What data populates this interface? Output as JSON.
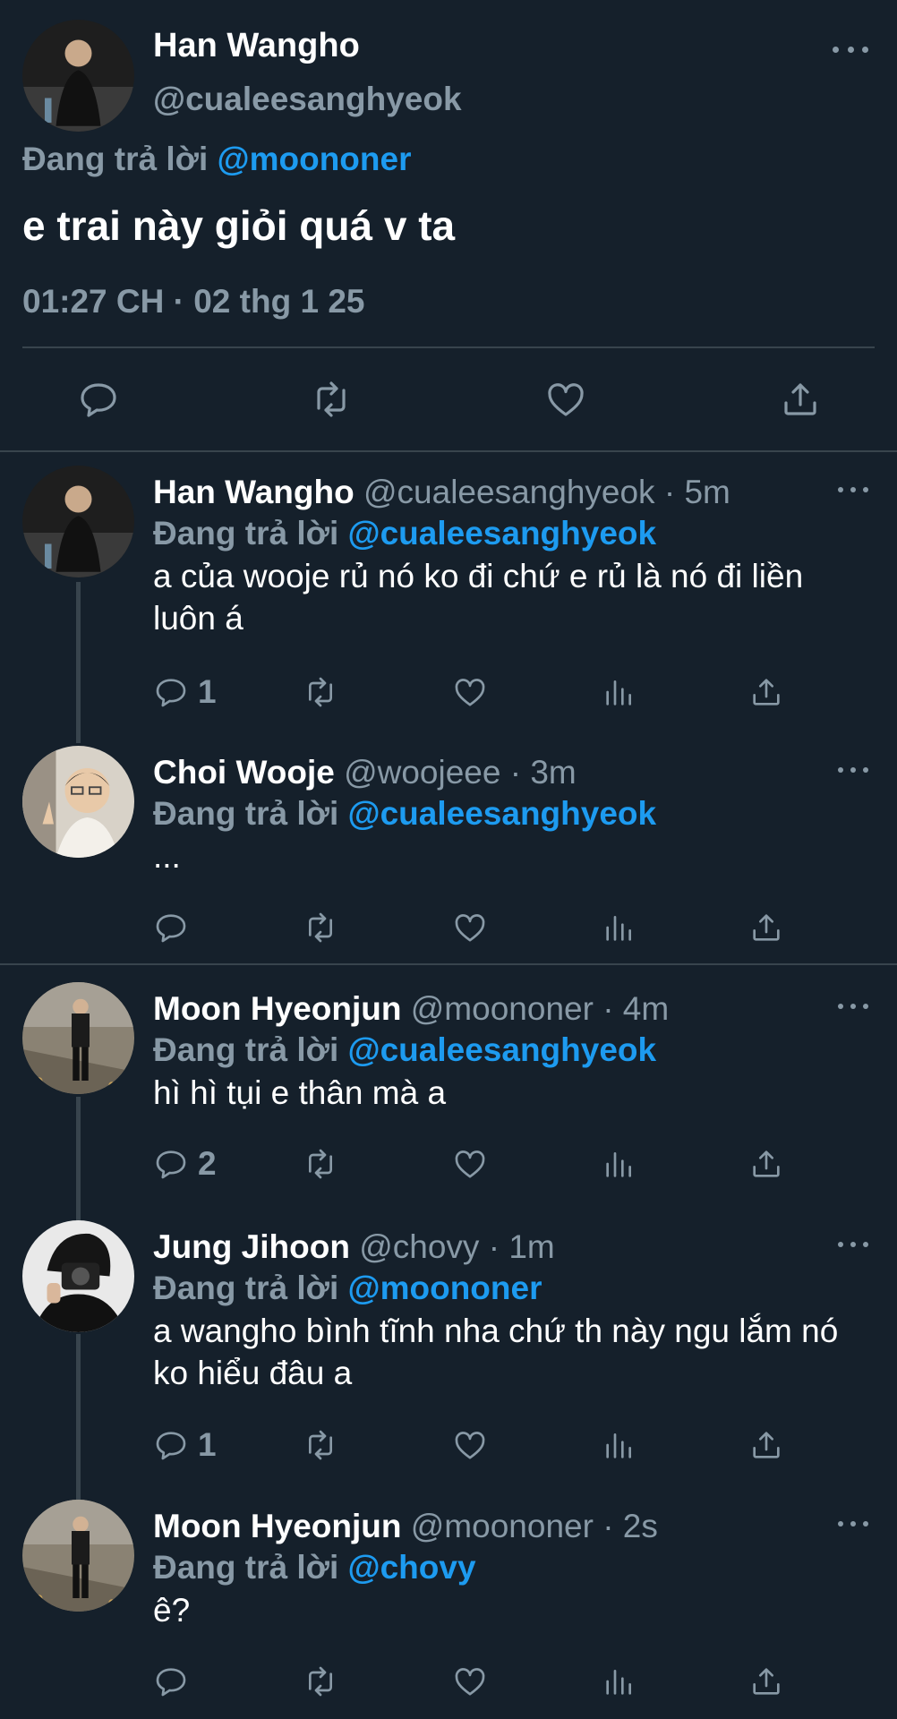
{
  "main_tweet": {
    "name": "Han Wangho",
    "handle": "@cualeesanghyeok",
    "reply_prefix": "Đang trả lời",
    "reply_mention": "@moononer",
    "text": "e trai này giỏi quá v ta",
    "timestamp": "01:27 CH · 02 thg 1 25"
  },
  "replies": [
    {
      "name": "Han Wangho",
      "handle": "@cualeesanghyeok · 5m",
      "reply_prefix": "Đang trả lời",
      "reply_mention": "@cualeesanghyeok",
      "text": "a của wooje rủ nó ko đi chứ e rủ là nó đi liền luôn á",
      "reply_count": "1"
    },
    {
      "name": "Choi Wooje",
      "handle": "@woojeee · 3m",
      "reply_prefix": "Đang trả lời",
      "reply_mention": "@cualeesanghyeok",
      "text": "...",
      "reply_count": ""
    },
    {
      "name": "Moon Hyeonjun",
      "handle": "@moononer · 4m",
      "reply_prefix": "Đang trả lời",
      "reply_mention": "@cualeesanghyeok",
      "text": "hì hì tụi e thân mà a",
      "reply_count": "2"
    },
    {
      "name": "Jung Jihoon",
      "handle": "@chovy · 1m",
      "reply_prefix": "Đang trả lời",
      "reply_mention": "@moononer",
      "text": "a wangho bình tĩnh nha chứ th này ngu lắm nó ko hiểu đâu a",
      "reply_count": "1"
    },
    {
      "name": "Moon Hyeonjun",
      "handle": "@moononer · 2s",
      "reply_prefix": "Đang trả lời",
      "reply_mention": "@chovy",
      "text": "ê?",
      "reply_count": ""
    }
  ],
  "icons": {
    "reply": "reply-icon",
    "retweet": "retweet-icon",
    "like": "like-icon",
    "analytics": "analytics-icon",
    "share": "share-icon",
    "more": "more-icon"
  },
  "colors": {
    "background": "#15202b",
    "divider": "#38444d",
    "secondary_text": "#8899a6",
    "mention": "#1d9bf0"
  }
}
